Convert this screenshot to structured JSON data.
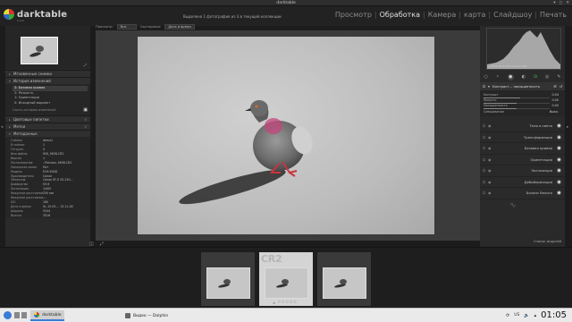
{
  "window": {
    "title": "darktable",
    "buttons": [
      "▾",
      "◻",
      "✕"
    ]
  },
  "header": {
    "app_name": "darktable",
    "version": "2.4.4",
    "info": "Выделено 1 фотография из 3 в текущей коллекции",
    "views": [
      "Просмотр",
      "Обработка",
      "Камера",
      "карта",
      "Слайдшоу",
      "Печать"
    ],
    "separator": "|",
    "active_view": "Обработка"
  },
  "toolbar": {
    "view_label": "Просмотр:",
    "view_value": "Все",
    "sort_label": "Сортировка:",
    "sort_value": "Дата и время"
  },
  "left_panel": {
    "sections_top": [
      "Мгновенные снимки",
      "История изменений"
    ],
    "history": [
      "3: Базовая кривая",
      "2: Резкость",
      "1: Ориентация",
      "0: Исходный вариант"
    ],
    "history_selected_index": 0,
    "history_footer": "Сжать историю изменений",
    "sections_mid": [
      "Цветовые пипетки",
      "Метки",
      "Метаданные"
    ],
    "metadata": [
      {
        "k": "Съёмка",
        "v": "demo1"
      },
      {
        "k": "В съёмке",
        "v": "1"
      },
      {
        "k": "Отгрупп.",
        "v": "0"
      },
      {
        "k": "Имя файла",
        "v": "IMG_9638.CR2"
      },
      {
        "k": "Версия",
        "v": "1"
      },
      {
        "k": "Расположение",
        "v": "..Pictures..9638.CR2"
      },
      {
        "k": "Локальная копия",
        "v": "Нет"
      },
      {
        "k": "Модель",
        "v": "EOS 600D"
      },
      {
        "k": "Производитель",
        "v": "Canon"
      },
      {
        "k": "Объектив",
        "v": "Canon EF-S 55-250..."
      },
      {
        "k": "Диафрагма",
        "v": "f/5.6"
      },
      {
        "k": "Экспозиция",
        "v": "1/400"
      },
      {
        "k": "Фокусное расстояние",
        "v": "250 мм"
      },
      {
        "k": "Фокусное расстояние",
        "v": "—"
      },
      {
        "k": "ISO",
        "v": "160"
      },
      {
        "k": "Дата и время",
        "v": "9/..15.03.... 15.11.28"
      },
      {
        "k": "Ширина",
        "v": "5344"
      },
      {
        "k": "Высота",
        "v": "3516"
      }
    ],
    "bottom_icons": [
      "◫",
      "⤢"
    ],
    "nav_icon": "⤢",
    "section_arrows": {
      "collapsed": "▸",
      "expanded": "▾",
      "reset": "↺"
    }
  },
  "right_panel": {
    "exif_line": "1/400 f/5.6 250 мм ISO 160",
    "module_group_icons": [
      "○",
      "⚬",
      "◉",
      "◐",
      "⊙",
      "◎",
      "✎"
    ],
    "expanded_module": {
      "title": "Контраст... насыщенность",
      "sliders": [
        {
          "label": "Контраст",
          "value": "0.04",
          "fill": 0.55
        },
        {
          "label": "Яркость",
          "value": "0.00",
          "fill": 0.5
        },
        {
          "label": "Насыщенность",
          "value": "0.00",
          "fill": 0.5
        }
      ],
      "combo": {
        "label": "Смешивание",
        "value": "Выкл."
      }
    },
    "modules": [
      "Тени и света",
      "Трансформация",
      "Базовая кривая",
      "Ориентация",
      "Экспозиция",
      "Дебайеризация",
      "Баланс белого"
    ],
    "bottom_link": "Список модулей"
  },
  "filmstrip": {
    "ext_label": "CR2",
    "stars": "☆☆☆☆☆",
    "reject": "⊘"
  },
  "taskbar": {
    "tasks": [
      "darktable",
      "Видео — Dolphin"
    ],
    "lang": "US",
    "clock": "01:05"
  },
  "colors": {
    "background": "#1c1c1c",
    "panel": "#2a2a2a",
    "accent": "#3a7bd5",
    "pigeon_neck": "#c2457e"
  }
}
